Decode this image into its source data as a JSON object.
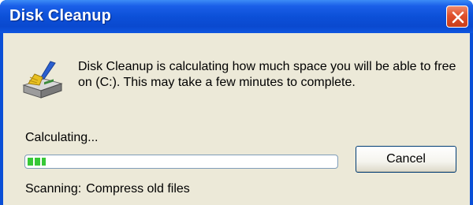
{
  "window": {
    "title": "Disk Cleanup",
    "icon": "close-icon"
  },
  "dialog": {
    "app_icon": "disk-cleanup-icon",
    "message": "Disk Cleanup is calculating how much space you will be able to free on  (C:). This may take a few minutes to complete.",
    "calculating_label": "Calculating...",
    "progress_fraction": 0.06,
    "cancel_label": "Cancel",
    "status_label": "Scanning:",
    "status_value": "Compress old files"
  },
  "colors": {
    "titlebar": "#0c50d8",
    "close_button": "#e0502c",
    "client_background": "#ece9d8",
    "progress_fill": "#37c837",
    "button_border": "#003c74"
  }
}
